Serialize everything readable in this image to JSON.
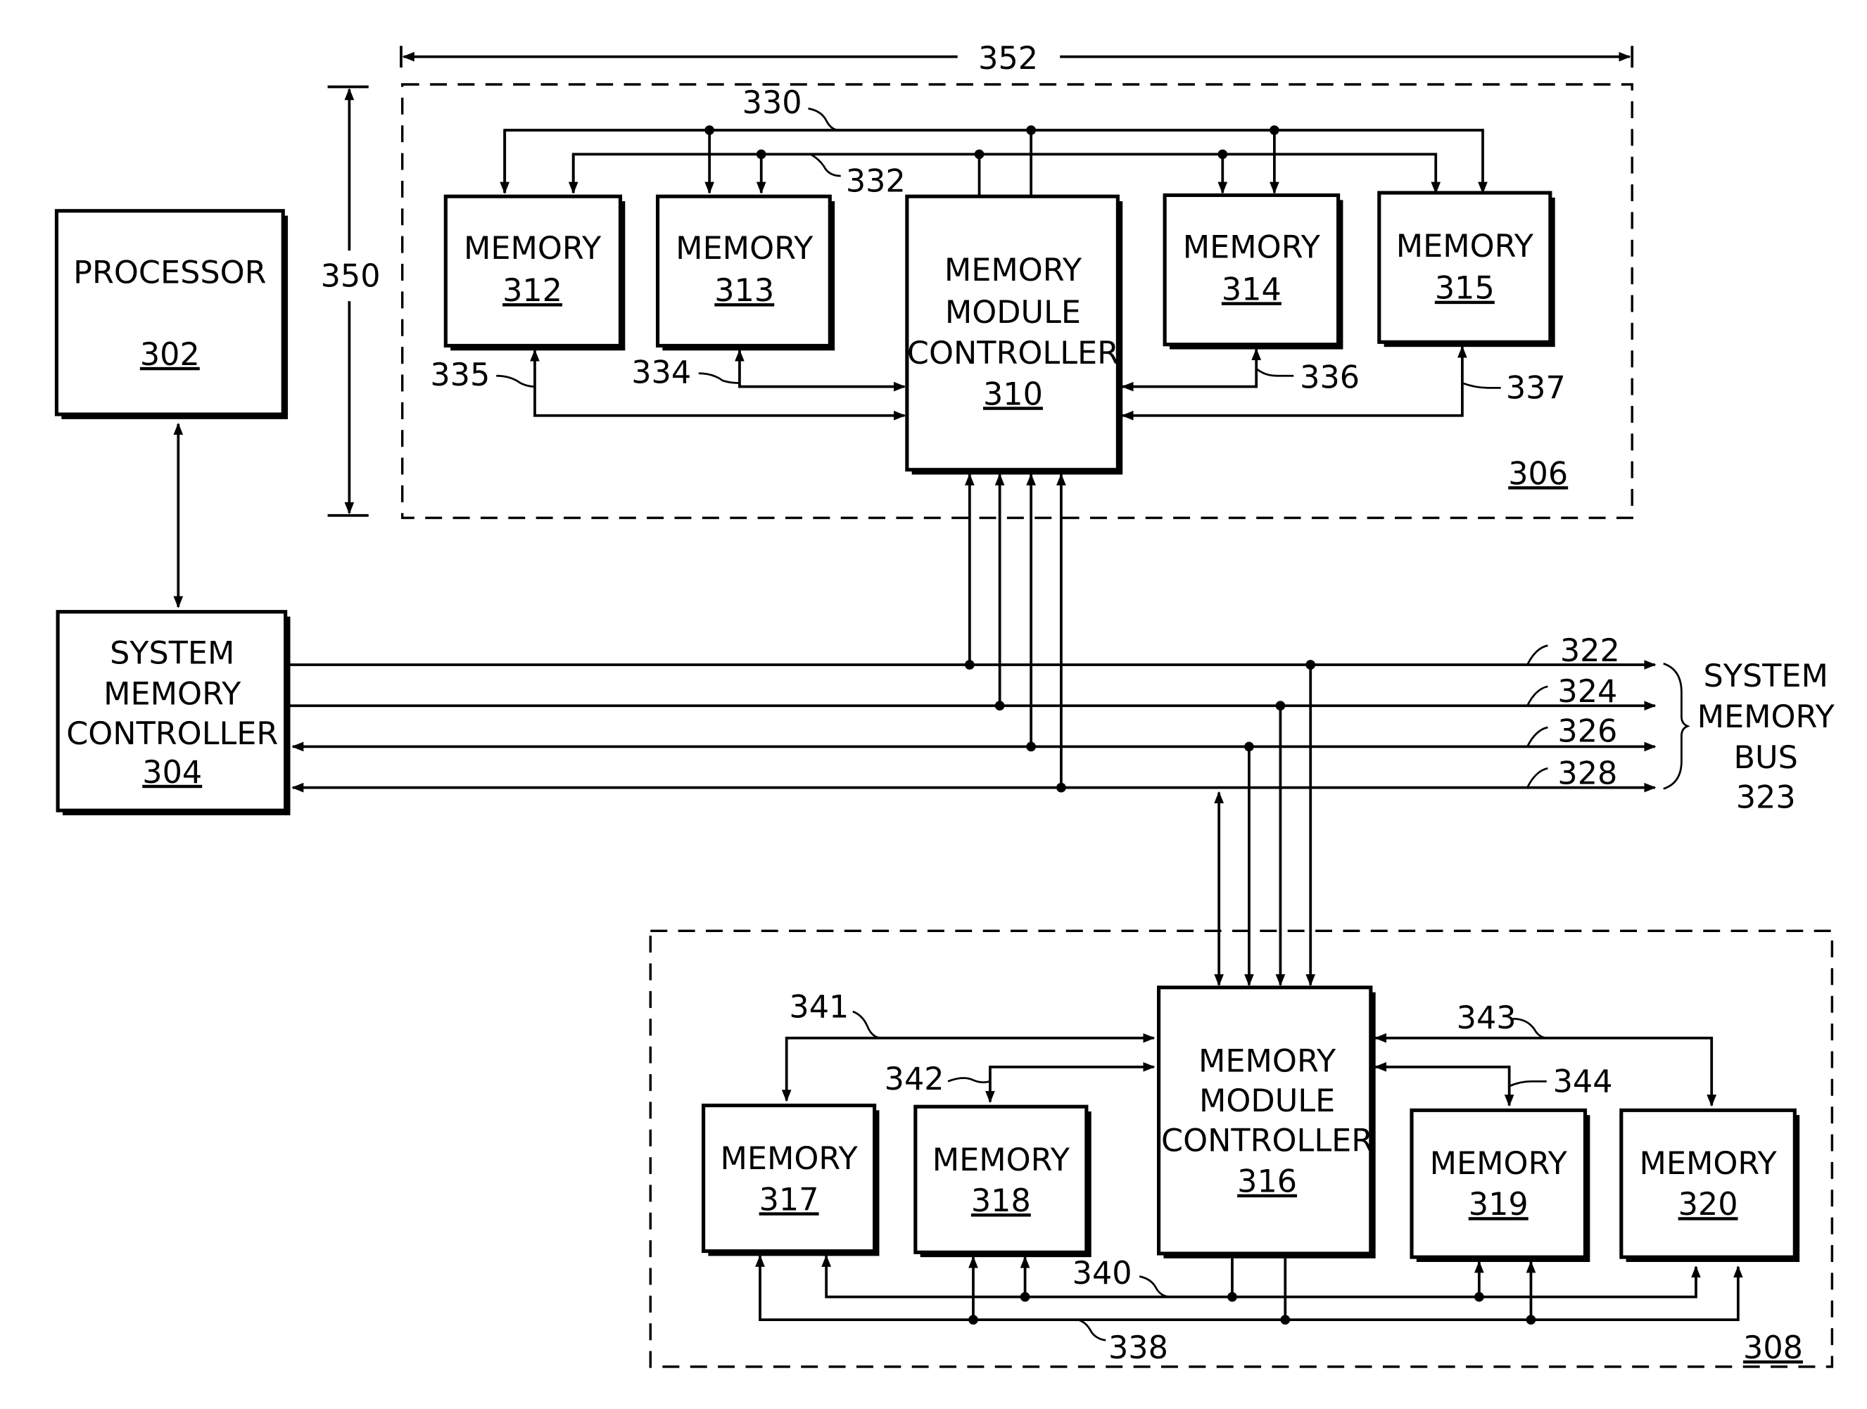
{
  "figure": {
    "processor": {
      "name": "PROCESSOR",
      "ref": "302"
    },
    "system_memory_controller": {
      "lines": [
        "SYSTEM",
        "MEMORY",
        "CONTROLLER"
      ],
      "ref": "304"
    },
    "module_top": {
      "ref": "306",
      "controller": {
        "lines": [
          "MEMORY",
          "MODULE",
          "CONTROLLER"
        ],
        "ref": "310"
      },
      "memories": [
        {
          "name": "MEMORY",
          "ref": "312"
        },
        {
          "name": "MEMORY",
          "ref": "313"
        },
        {
          "name": "MEMORY",
          "ref": "314"
        },
        {
          "name": "MEMORY",
          "ref": "315"
        }
      ],
      "bus_refs": {
        "a": "330",
        "b": "332"
      },
      "link_refs": [
        "335",
        "334",
        "336",
        "337"
      ],
      "width_ref": "352",
      "height_ref": "350"
    },
    "module_bottom": {
      "ref": "308",
      "controller": {
        "lines": [
          "MEMORY",
          "MODULE",
          "CONTROLLER"
        ],
        "ref": "316"
      },
      "memories": [
        {
          "name": "MEMORY",
          "ref": "317"
        },
        {
          "name": "MEMORY",
          "ref": "318"
        },
        {
          "name": "MEMORY",
          "ref": "319"
        },
        {
          "name": "MEMORY",
          "ref": "320"
        }
      ],
      "bus_refs": {
        "a": "338",
        "b": "340"
      },
      "link_refs": [
        "341",
        "342",
        "343",
        "344"
      ]
    },
    "system_bus": {
      "lines": [
        "SYSTEM",
        "MEMORY",
        "BUS"
      ],
      "ref": "323",
      "line_refs": [
        "322",
        "324",
        "326",
        "328"
      ]
    }
  }
}
